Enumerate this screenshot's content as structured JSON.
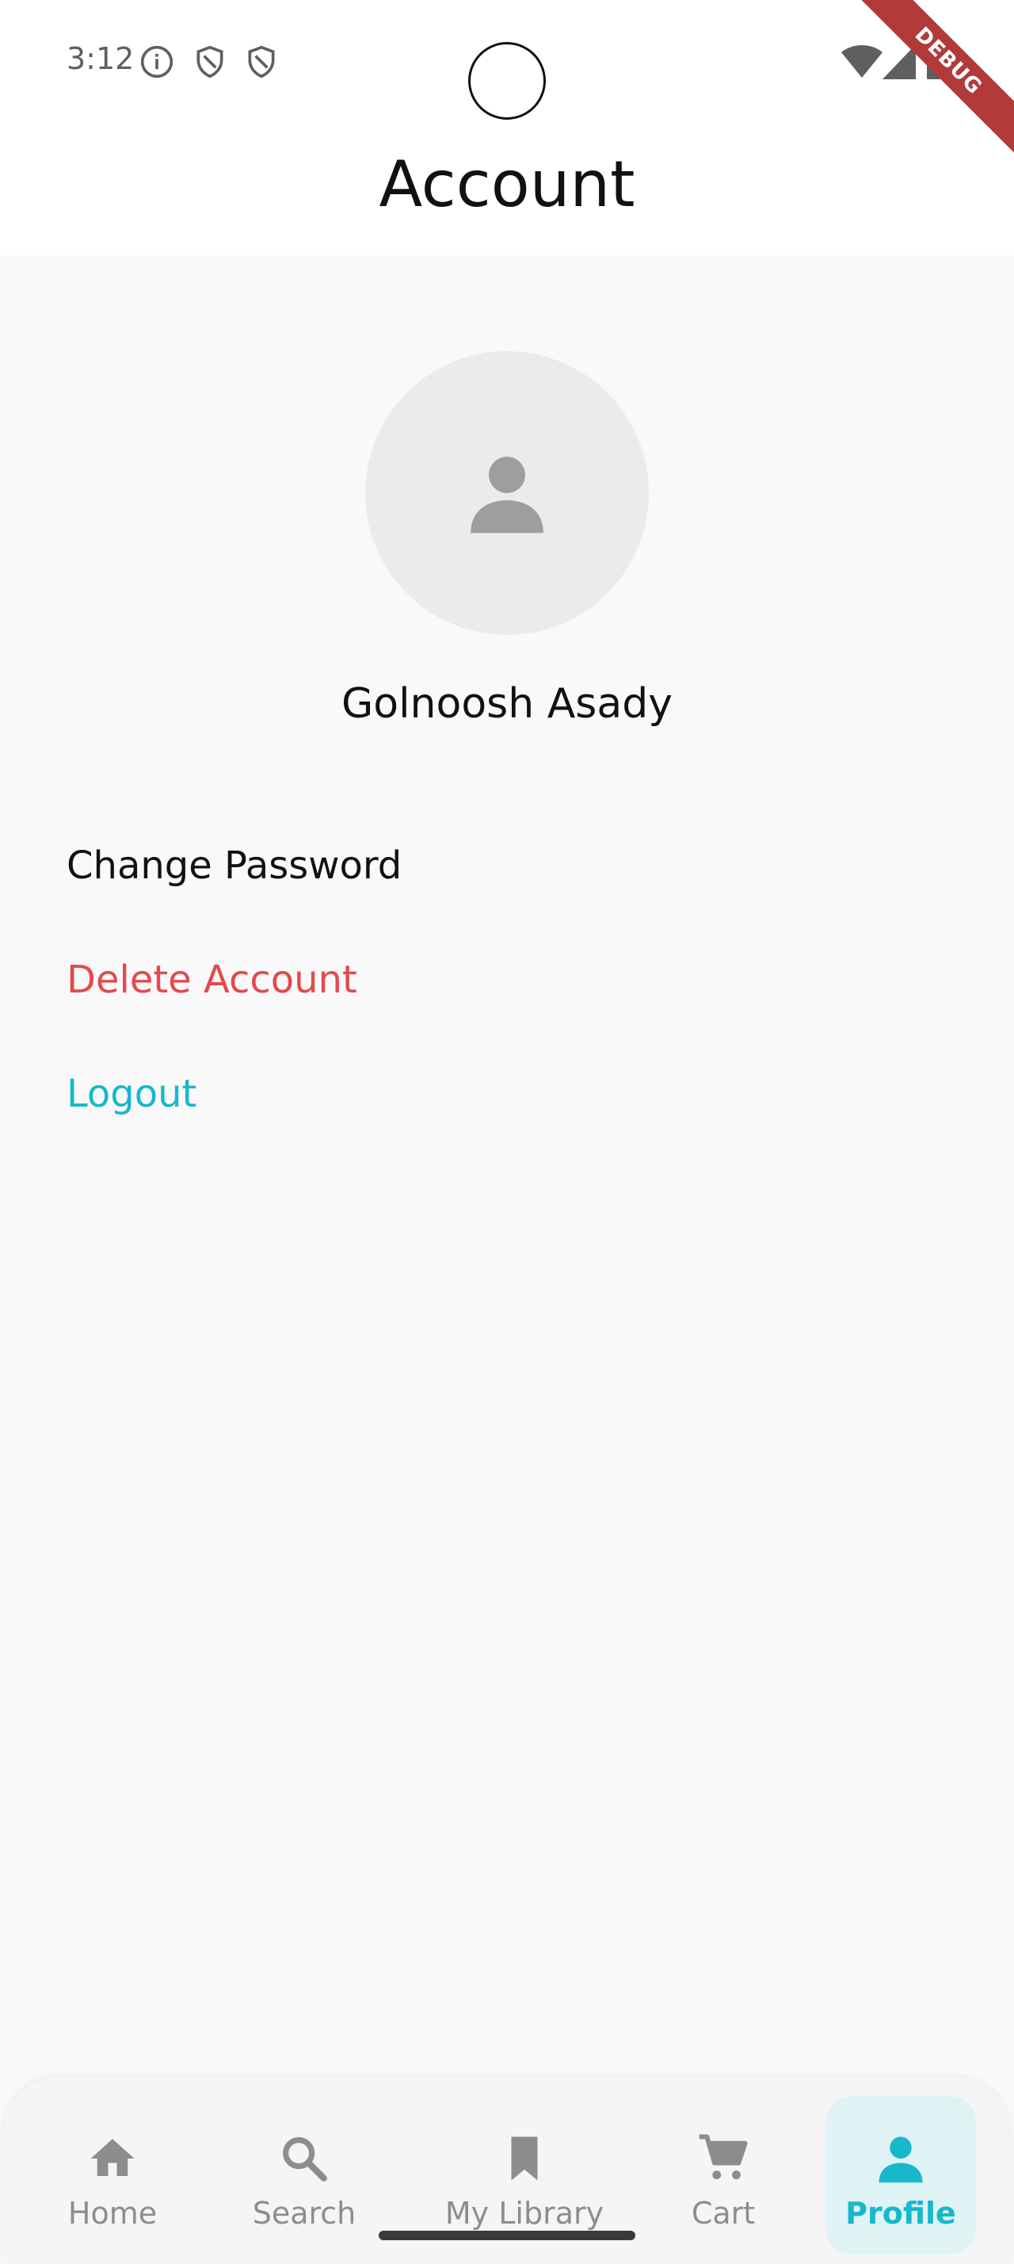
{
  "status_bar": {
    "time": "3:12",
    "icons": [
      "info-icon",
      "shield-icon",
      "shield-icon",
      "wifi-icon",
      "signal-icon",
      "battery-icon"
    ]
  },
  "debug_banner": "DEBUG",
  "app_bar": {
    "title": "Account"
  },
  "profile": {
    "avatar_icon": "person-icon",
    "name": "Golnoosh Asady"
  },
  "menu": {
    "change_password": "Change Password",
    "delete_account": "Delete Account",
    "logout": "Logout"
  },
  "colors": {
    "accent": "#17b8cc",
    "danger": "#e5484d",
    "background": "#f9f9f9",
    "active_tab_bg": "#dff3f5"
  },
  "bottom_nav": {
    "items": [
      {
        "label": "Home",
        "icon": "home-icon",
        "active": false
      },
      {
        "label": "Search",
        "icon": "search-icon",
        "active": false
      },
      {
        "label": "My Library",
        "icon": "bookmark-icon",
        "active": false
      },
      {
        "label": "Cart",
        "icon": "cart-icon",
        "active": false
      },
      {
        "label": "Profile",
        "icon": "person-icon",
        "active": true
      }
    ]
  }
}
